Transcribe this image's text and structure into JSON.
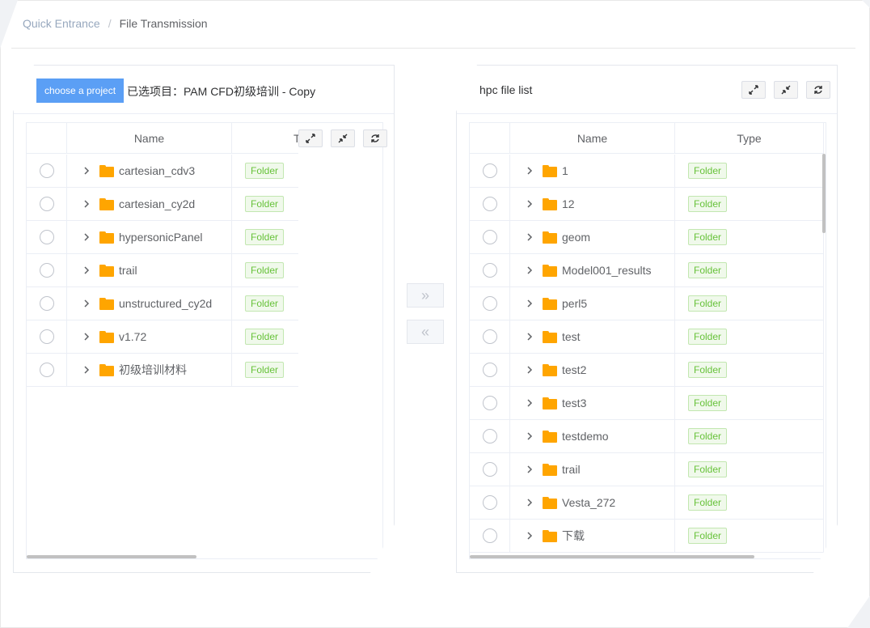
{
  "breadcrumb": {
    "link": "Quick Entrance",
    "separator": "/",
    "current": "File Transmission"
  },
  "left_panel": {
    "choose_button": "choose a project",
    "selected_label": "已选项目：PAM CFD初级培训 - Copy",
    "columns": {
      "name": "Name",
      "type": "T"
    },
    "rows": [
      {
        "name": "cartesian_cdv3",
        "type": "Folder"
      },
      {
        "name": "cartesian_cy2d",
        "type": "Folder"
      },
      {
        "name": "hypersonicPanel",
        "type": "Folder"
      },
      {
        "name": "trail",
        "type": "Folder"
      },
      {
        "name": "unstructured_cy2d",
        "type": "Folder"
      },
      {
        "name": "v1.72",
        "type": "Folder"
      },
      {
        "name": "初级培训材料",
        "type": "Folder"
      }
    ]
  },
  "right_panel": {
    "title": "hpc file list",
    "columns": {
      "name": "Name",
      "type": "Type"
    },
    "rows": [
      {
        "name": "1",
        "type": "Folder"
      },
      {
        "name": "12",
        "type": "Folder"
      },
      {
        "name": "geom",
        "type": "Folder"
      },
      {
        "name": "Model001_results",
        "type": "Folder"
      },
      {
        "name": "perl5",
        "type": "Folder"
      },
      {
        "name": "test",
        "type": "Folder"
      },
      {
        "name": "test2",
        "type": "Folder"
      },
      {
        "name": "test3",
        "type": "Folder"
      },
      {
        "name": "testdemo",
        "type": "Folder"
      },
      {
        "name": "trail",
        "type": "Folder"
      },
      {
        "name": "Vesta_272",
        "type": "Folder"
      },
      {
        "name": "下载",
        "type": "Folder"
      }
    ]
  },
  "transfer": {
    "to_right": "»",
    "to_left": "«"
  },
  "icons": [
    "expand-icon",
    "compress-icon",
    "refresh-icon",
    "chevron-right-icon",
    "folder-icon",
    "radio-icon"
  ],
  "colors": {
    "primary": "#5b9ff5",
    "folder": "#ffa500",
    "tag_text": "#67c23a",
    "tag_border": "#c2e7b0",
    "tag_bg": "#f0f9eb"
  }
}
